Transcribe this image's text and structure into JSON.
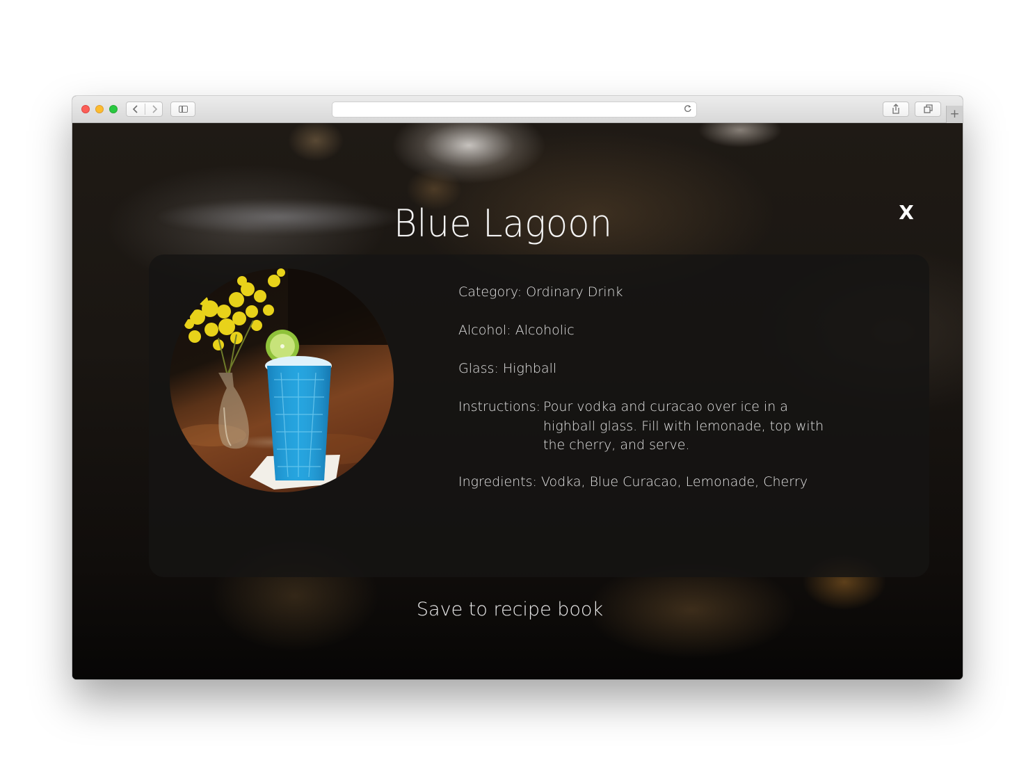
{
  "browser": {
    "address_value": "",
    "address_placeholder": "",
    "nav_back_icon": "‹",
    "nav_forward_icon": "›",
    "reload_icon": "↻",
    "share_icon": "⇧",
    "tabs_icon": "⧉",
    "new_tab_icon": "+"
  },
  "modal": {
    "title": "Blue Lagoon",
    "close_label": "X",
    "image_alt": "Blue Lagoon cocktail",
    "details": {
      "category_label": "Category:",
      "category_value": "Ordinary Drink",
      "alcohol_label": "Alcohol:",
      "alcohol_value": "Alcoholic",
      "glass_label": "Glass:",
      "glass_value": "Highball",
      "instructions_label": "Instructions:",
      "instructions_value": "Pour vodka and curacao over ice in a highball glass. Fill with lemonade, top with the cherry, and serve.",
      "ingredients_label": "Ingredients:",
      "ingredients_value": "Vodka, Blue Curacao, Lemonade, Cherry"
    },
    "save_label": "Save to recipe book"
  },
  "colors": {
    "traffic_red": "#fc5f57",
    "traffic_yellow": "#fdbc2e",
    "traffic_green": "#28c840",
    "drink_blue": "#1f9fdc",
    "flower_yellow": "#e6d21c",
    "lime_green": "#8fc23a"
  }
}
